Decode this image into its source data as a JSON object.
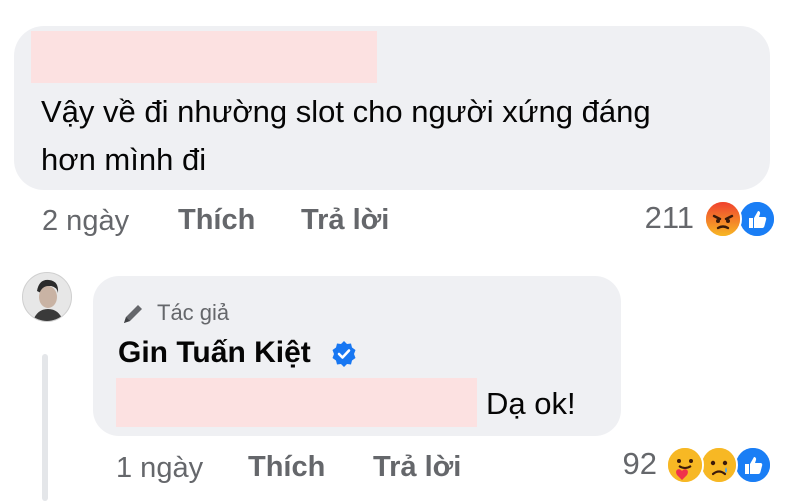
{
  "comment1": {
    "text_line1": "Vậy về đi nhường slot cho người xứng đáng",
    "text_line2": "hơn mình đi",
    "time": "2 ngày",
    "like_label": "Thích",
    "reply_label": "Trả lời",
    "reaction_count": "211",
    "reactions": [
      "angry-icon",
      "like-icon"
    ]
  },
  "reply": {
    "author_tag": "Tác giả",
    "author_name": "Gin Tuấn Kiệt",
    "verified_icon": "verified-badge-icon",
    "text": "Dạ ok!",
    "time": "1 ngày",
    "like_label": "Thích",
    "reply_label": "Trả lời",
    "reaction_count": "92",
    "reactions": [
      "care-icon",
      "sad-icon",
      "like-icon"
    ]
  },
  "colors": {
    "bubble": "#eff0f3",
    "meta_text": "#65676b",
    "like_blue": "#1877f2",
    "angry_red": "#e9710f",
    "redaction": "#fce1e1"
  }
}
